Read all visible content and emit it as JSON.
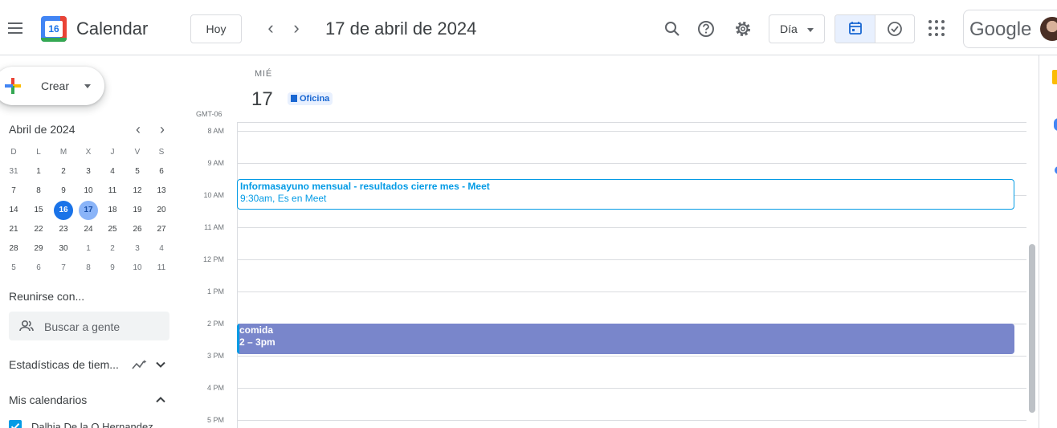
{
  "header": {
    "app_title": "Calendar",
    "logo_day": "16",
    "today_button": "Hoy",
    "date_title": "17 de abril de 2024",
    "view_select": "Día",
    "brand": "Google"
  },
  "sidebar": {
    "create_label": "Crear",
    "mini_month_title": "Abril de 2024",
    "weekday_heads": [
      "D",
      "L",
      "M",
      "X",
      "J",
      "V",
      "S"
    ],
    "weeks": [
      [
        "31",
        "1",
        "2",
        "3",
        "4",
        "5",
        "6"
      ],
      [
        "7",
        "8",
        "9",
        "10",
        "11",
        "12",
        "13"
      ],
      [
        "14",
        "15",
        "16",
        "17",
        "18",
        "19",
        "20"
      ],
      [
        "21",
        "22",
        "23",
        "24",
        "25",
        "26",
        "27"
      ],
      [
        "28",
        "29",
        "30",
        "1",
        "2",
        "3",
        "4"
      ],
      [
        "5",
        "6",
        "7",
        "8",
        "9",
        "10",
        "11"
      ]
    ],
    "meet_title": "Reunirse con...",
    "search_people_placeholder": "Buscar a gente",
    "time_insights_title": "Estadísticas de tiem...",
    "my_calendars_title": "Mis calendarios",
    "calendar_item": "Dalhia De la O Hernandez"
  },
  "day_view": {
    "day_name": "MIÉ",
    "day_number": "17",
    "working_location": "Oficina",
    "timezone": "GMT-06",
    "hours": [
      "8 AM",
      "9 AM",
      "10 AM",
      "11 AM",
      "12 PM",
      "1 PM",
      "2 PM",
      "3 PM",
      "4 PM",
      "5 PM"
    ],
    "events": [
      {
        "title": "Informasayuno mensual - resultados cierre mes - Meet",
        "detail": "9:30am, Es en Meet"
      },
      {
        "title": "comida",
        "detail": "2 – 3pm"
      }
    ]
  },
  "colors": {
    "accent": "#1a73e8",
    "event_outline": "#039be5",
    "event_fill": "#7986cb"
  }
}
